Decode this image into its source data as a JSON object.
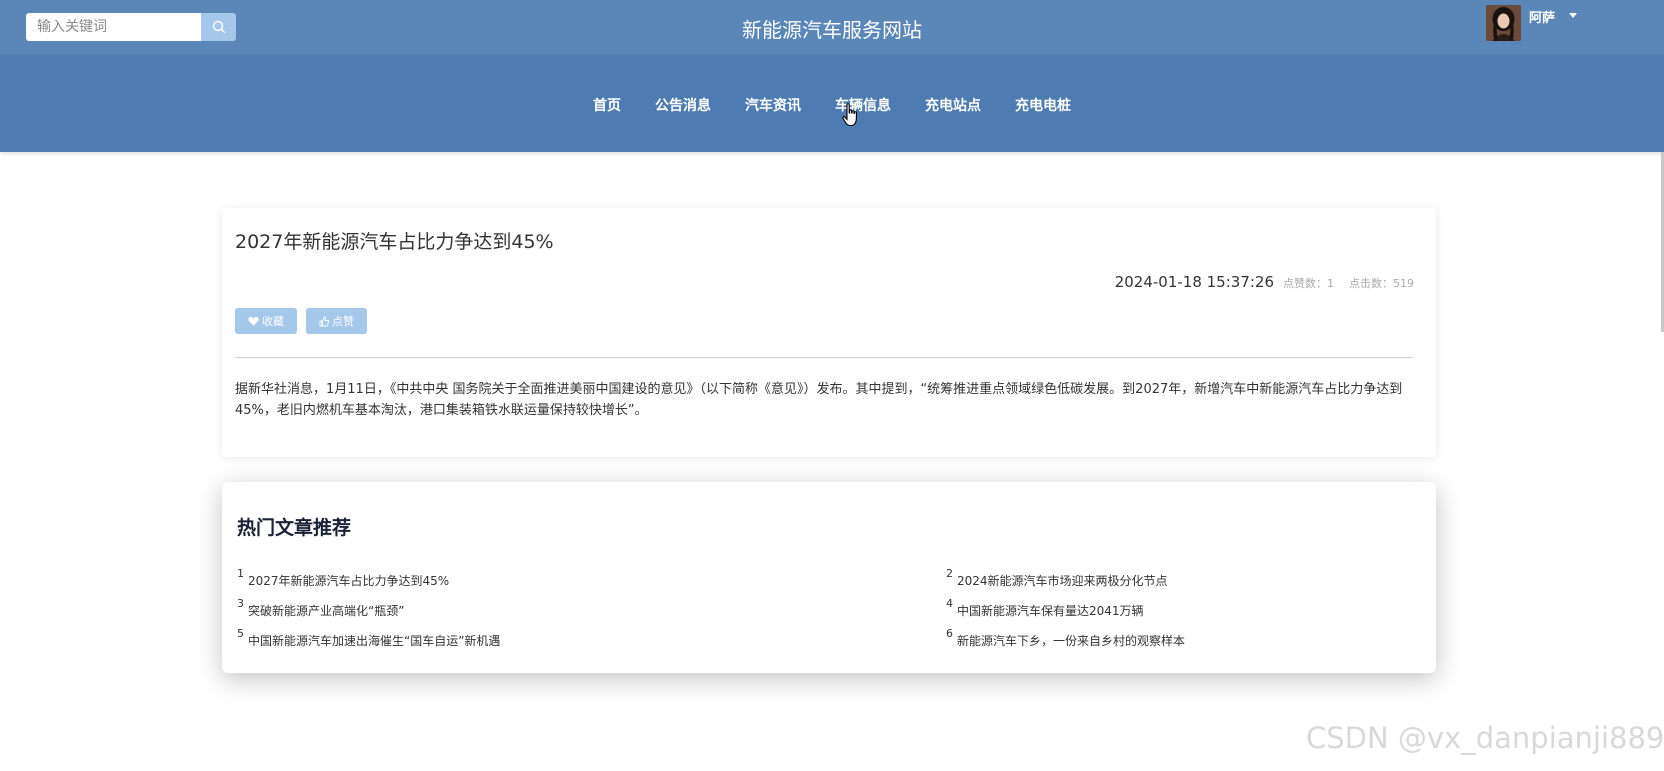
{
  "header": {
    "search_placeholder": "输入关键词",
    "site_title": "新能源汽车服务网站",
    "username": "阿萨"
  },
  "nav": {
    "items": [
      "首页",
      "公告消息",
      "汽车资讯",
      "车辆信息",
      "充电站点",
      "充电电桩"
    ]
  },
  "article": {
    "title": "2027年新能源汽车占比力争达到45%",
    "datetime": "2024-01-18 15:37:26",
    "likes_text": "点赞数：1",
    "clicks_text": "点击数：519",
    "favorite_label": "收藏",
    "like_label": "点赞",
    "body": "据新华社消息，1月11日，《中共中央 国务院关于全面推进美丽中国建设的意见》（以下简称《意见》）发布。其中提到，“统筹推进重点领域绿色低碳发展。到2027年，新增汽车中新能源汽车占比力争达到45%，老旧内燃机车基本淘汰，港口集装箱铁水联运量保持较快增长”。"
  },
  "hot": {
    "title": "热门文章推荐",
    "items": [
      {
        "num": "1",
        "text": "2027年新能源汽车占比力争达到45%"
      },
      {
        "num": "2",
        "text": "2024新能源汽车市场迎来两极分化节点"
      },
      {
        "num": "3",
        "text": "突破新能源产业高端化“瓶颈”"
      },
      {
        "num": "4",
        "text": "中国新能源汽车保有量达2041万辆"
      },
      {
        "num": "5",
        "text": "中国新能源汽车加速出海催生“国车自运”新机遇"
      },
      {
        "num": "6",
        "text": "新能源汽车下乡，一份来自乡村的观察样本"
      }
    ]
  },
  "watermark": "CSDN @vx_danpianji889",
  "colors": {
    "topbar": "#5a86b8",
    "navbar": "#4e7cb2",
    "button": "#a5c7ea"
  }
}
